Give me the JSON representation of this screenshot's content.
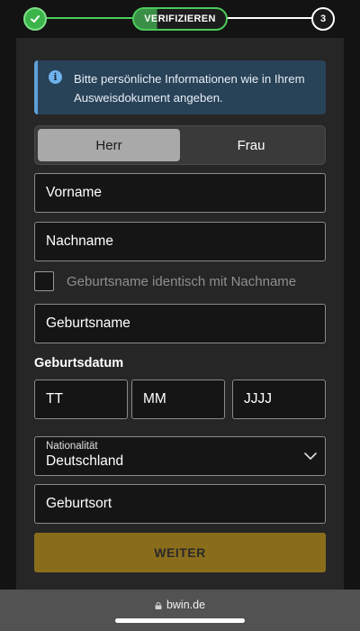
{
  "stepper": {
    "current_label": "VERIFIZIEREN",
    "step3_label": "3"
  },
  "info": {
    "text": "Bitte persönliche Informationen wie in Ihrem Ausweisdokument angeben."
  },
  "gender": {
    "options": [
      "Herr",
      "Frau"
    ],
    "selected": "Herr"
  },
  "fields": {
    "first_name": "Vorname",
    "last_name": "Nachname",
    "birth_name": "Geburtsname",
    "birth_place": "Geburtsort"
  },
  "checkbox": {
    "label": "Geburtsname identisch mit Nachname",
    "checked": false
  },
  "birthdate": {
    "label": "Geburtsdatum",
    "day": "TT",
    "month": "MM",
    "year": "JJJJ"
  },
  "nationality": {
    "label": "Nationalität",
    "value": "Deutschland"
  },
  "submit_label": "WEITER",
  "browser": {
    "url": "bwin.de"
  },
  "colors": {
    "accent_green": "#3bb54a",
    "submit_bg": "#8a6d1b",
    "info_bg": "#284258"
  }
}
